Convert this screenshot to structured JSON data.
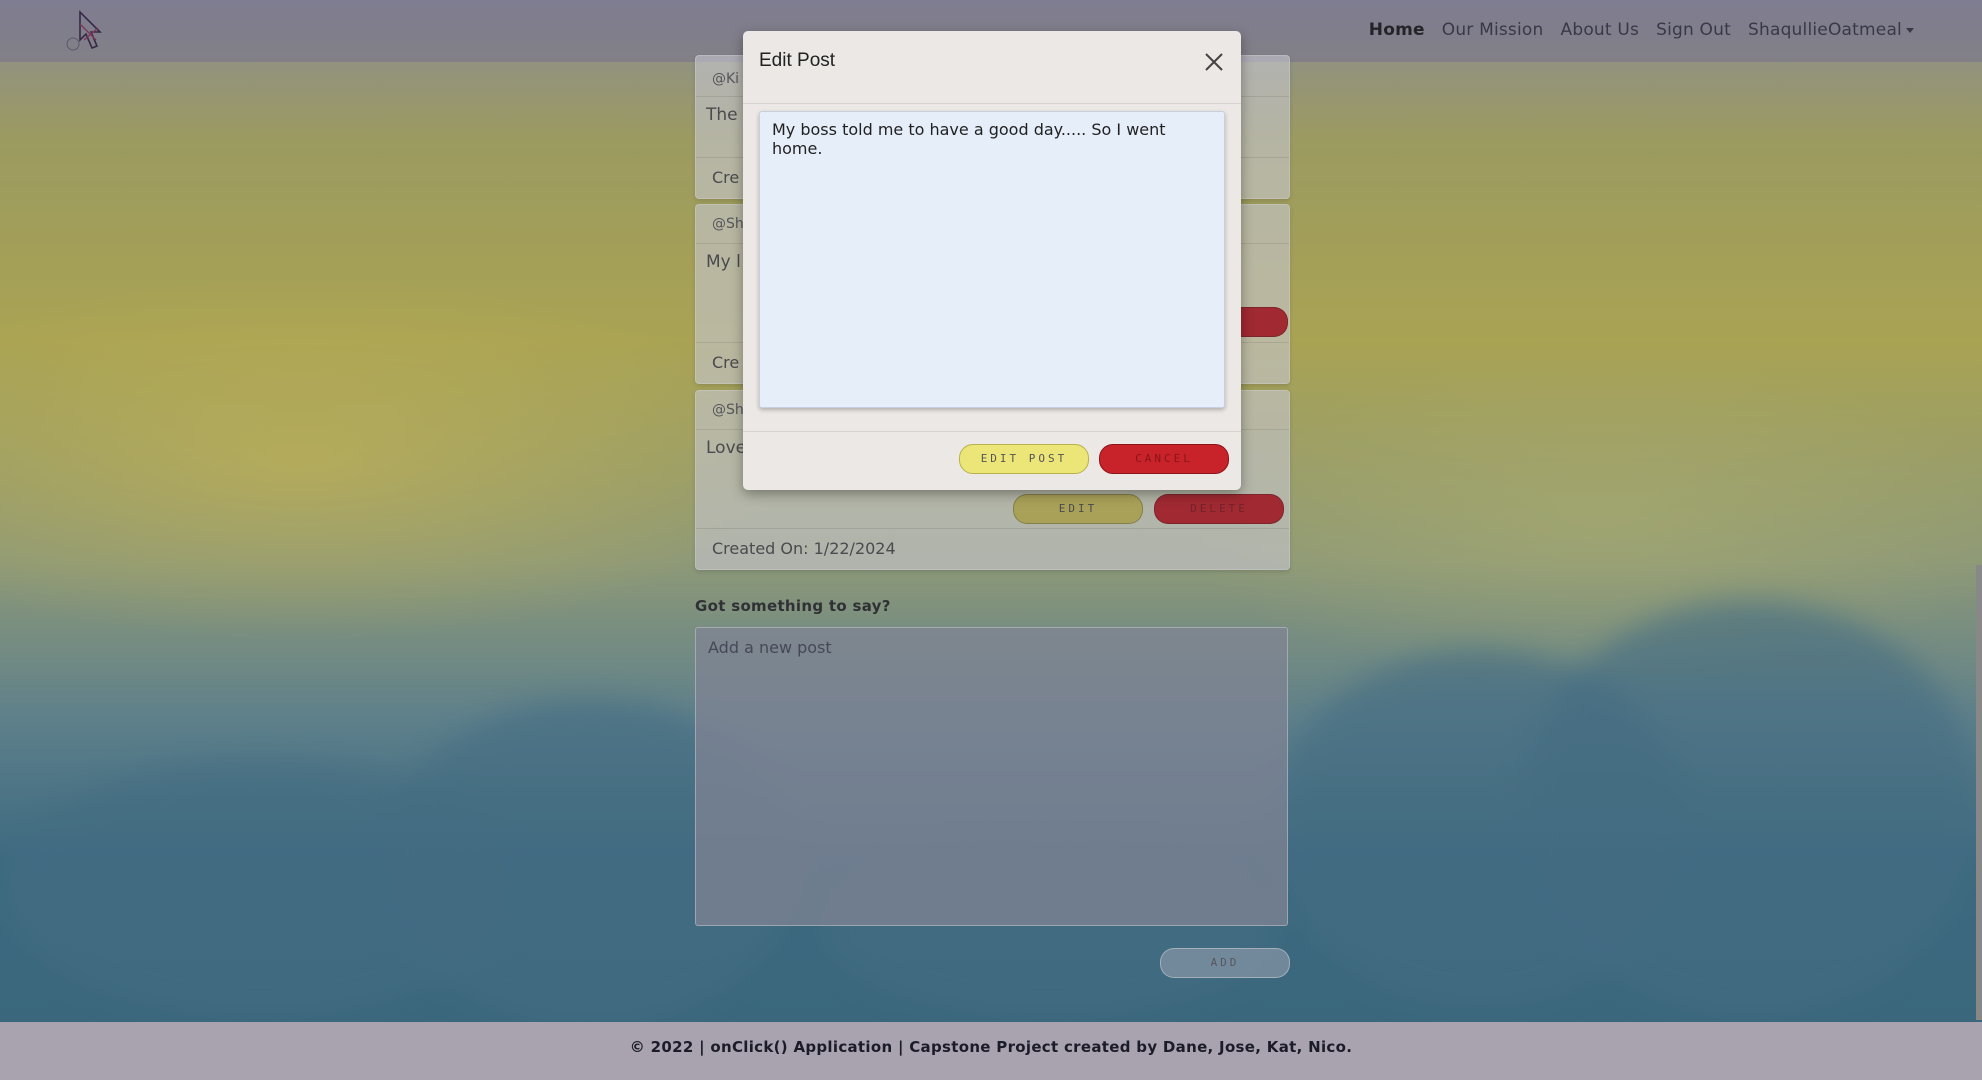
{
  "nav": {
    "links": [
      "Home",
      "Our Mission",
      "About Us",
      "Sign Out",
      "ShaqullieOatmeal"
    ]
  },
  "posts": [
    {
      "author": "@Ki",
      "text": "The p",
      "created": "Cre"
    },
    {
      "author": "@Sh",
      "text": "My l",
      "created": "Cre"
    },
    {
      "author": "@Sh",
      "text": "Love",
      "created": "Created On: 1/22/2024",
      "edit_label": "EDIT",
      "delete_label": "DELETE"
    }
  ],
  "modal": {
    "title": "Edit Post",
    "body_text": "My boss told me to have a good day..... So I went home.",
    "edit_button": "EDIT POST",
    "cancel_button": "CANCEL"
  },
  "new_post": {
    "prompt": "Got something to say?",
    "placeholder": "Add a new post",
    "add_button": "ADD"
  },
  "footer": {
    "text": "© 2022 | onClick() Application | Capstone Project created by Dane, Jose, Kat, Nico."
  },
  "colors": {
    "edit_yellow": "#c3b951",
    "delete_red": "#b7191e",
    "modal_edit_yellow": "#ece679",
    "modal_cancel_red": "#c8232a"
  },
  "icons": {
    "logo": "cursor-logo-icon",
    "close": "close-icon",
    "dropdown": "chevron-down-icon"
  }
}
